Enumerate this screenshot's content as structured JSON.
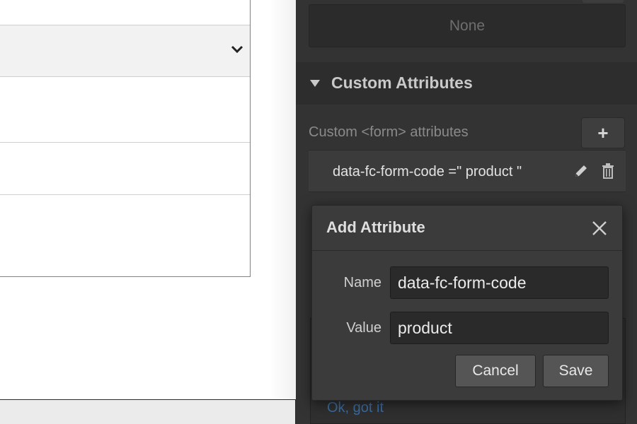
{
  "style_field": {
    "value": "None"
  },
  "custom_attributes": {
    "section_title": "Custom Attributes",
    "label": "Custom <form> attributes",
    "add_button": "+",
    "items": [
      {
        "text": "data-fc-form-code =\" product \""
      }
    ]
  },
  "modal": {
    "title": "Add Attribute",
    "name_label": "Name",
    "name_value": "data-fc-form-code",
    "value_label": "Value",
    "value_value": "product",
    "cancel_label": "Cancel",
    "save_label": "Save"
  },
  "tooltip": {
    "link": "Ok, got it"
  },
  "colors": {
    "panel_bg": "#333333",
    "modal_bg": "#3b3b3b",
    "selection_blue": "#3b93e0",
    "link_blue": "#3c6ea3"
  }
}
